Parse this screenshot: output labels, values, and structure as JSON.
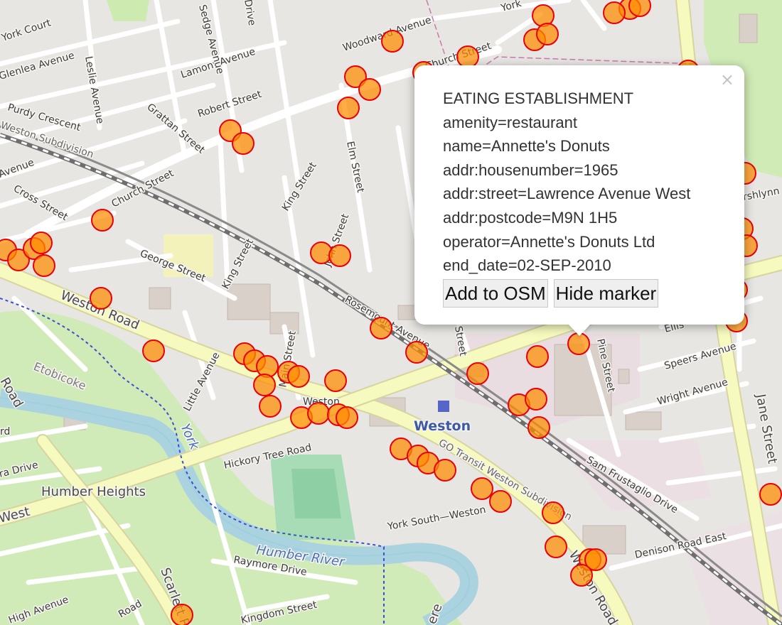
{
  "popup": {
    "lines": [
      "EATING ESTABLISHMENT",
      "amenity=restaurant",
      "name=Annette's Donuts",
      "addr:housenumber=1965",
      "addr:street=Lawrence Avenue West",
      "addr:postcode=M9N 1H5",
      "operator=Annette's Donuts Ltd",
      "end_date=02-SEP-2010"
    ],
    "add_button": "Add to OSM",
    "hide_button": "Hide marker",
    "close_glyph": "×"
  },
  "map_labels": {
    "york_court": "York Court",
    "leslie_avenue": "Leslie Avenue",
    "lamont_avenue": "Lamont Avenue",
    "sedge_avenue": "Sedge Avenue",
    "drive_top": "Drive",
    "woodward": "Woodward Avenue",
    "church_top": "Church Street",
    "york_top": "York",
    "glenlea": "Glenlea Avenue",
    "robert_street": "Robert Street",
    "purdy_crescent": "Purdy Crescent",
    "grattan_street": "Grattan Street",
    "weston_subdivision": "Weston Subdivision",
    "church_street": "Church Street",
    "elm_street": "Elm Street",
    "avenue_left": "Avenue",
    "cross_street": "Cross Street",
    "king_street_1": "King Street",
    "king_street_2": "King Street",
    "george_street": "George Street",
    "weston_road": "Weston Road",
    "rosemount": "Rosemount Avenue",
    "john_street": "John Street",
    "little_avenue": "Little Avenue",
    "main_street": "Main Street",
    "weston_small": "Weston",
    "weston_station": "Weston",
    "etobicoke": "Etobicoke",
    "road_left": "Road",
    "hickory_tree": "Hickory Tree Road",
    "humber_heights": "Humber Heights",
    "west_left": "West",
    "ra_drive": "ra Drive",
    "rd_left": "rd",
    "york_river": "York",
    "go_transit": "GO Transit Weston Subdivision",
    "humber_river": "Humber River",
    "york_south_weston": "York South—Weston",
    "raymore_drive": "Raymore Drive",
    "scarlett_road": "Scarlett Road",
    "high_avenue": "High Avenue",
    "kingdom_street": "Kingdom Street",
    "road_bottom": "Road",
    "ere": "ere",
    "weston_road_south": "Weston Road",
    "pine_street": "Pine Street",
    "street_mid": "Street",
    "ellis": "Ellis",
    "speers_avenue": "Speers Avenue",
    "wright_avenue": "Wright Avenue",
    "jane_street": "Jane Street",
    "sam_frustaglio": "Sam Frustaglio Drive",
    "denison_road_east": "Denison Road East",
    "shlynn": "rshlynn"
  }
}
